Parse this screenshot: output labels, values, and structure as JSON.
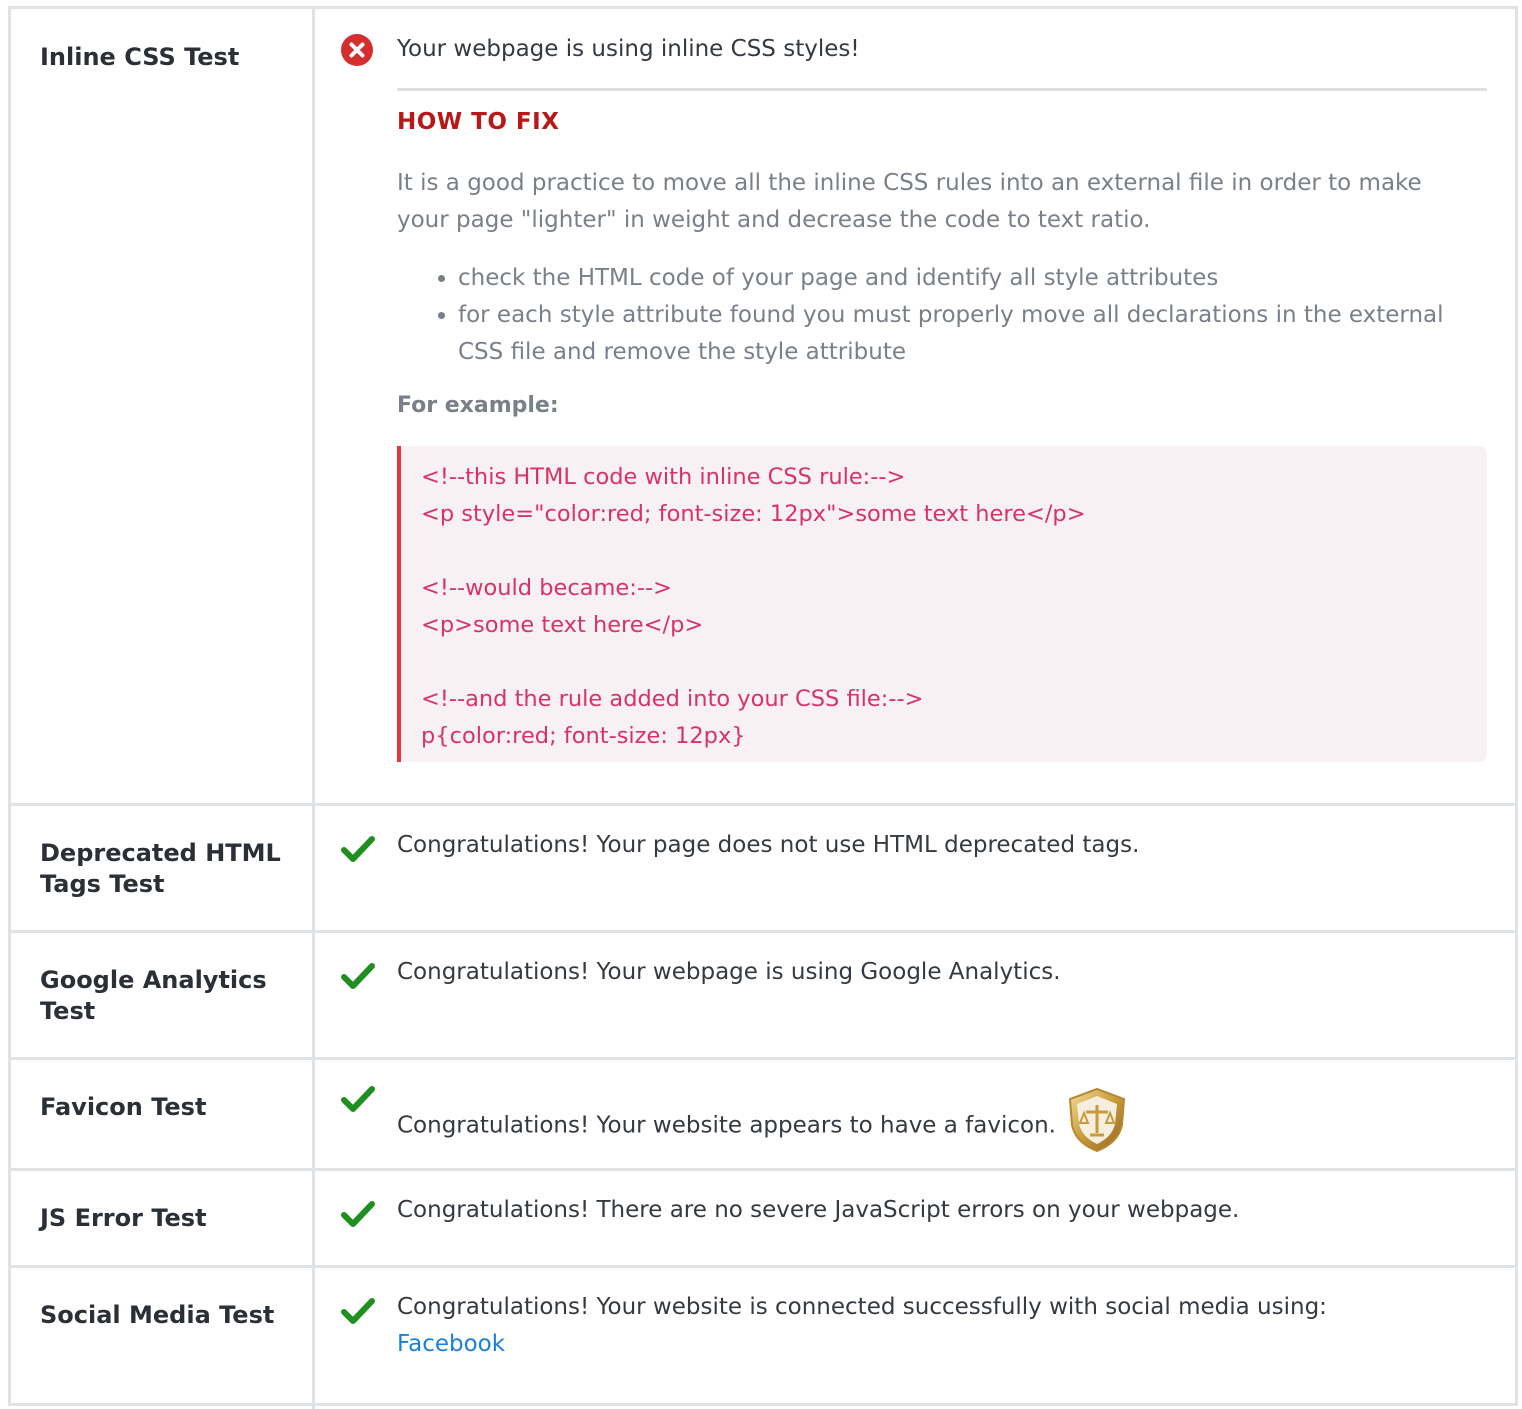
{
  "rows": [
    {
      "label": "Inline CSS Test",
      "status": "error",
      "message": "Your webpage is using inline CSS styles!",
      "how_to_fix": {
        "title": "HOW TO FIX",
        "paragraph": "It is a good practice to move all the inline CSS rules into an external file in order to make your page \"lighter\" in weight and decrease the code to text ratio.",
        "steps": [
          "check the HTML code of your page and identify all style attributes",
          "for each style attribute found you must properly move all declarations in the external CSS file and remove the style attribute"
        ],
        "example_label": "For example:",
        "code_lines": [
          "<!--this HTML code with inline CSS rule:-->",
          "<p style=\"color:red; font-size: 12px\">some text here</p>",
          "",
          "<!--would became:-->",
          "<p>some text here</p>",
          "",
          "<!--and the rule added into your CSS file:-->",
          "p{color:red; font-size: 12px}"
        ]
      }
    },
    {
      "label": "Deprecated HTML Tags Test",
      "status": "pass",
      "message": "Congratulations! Your page does not use HTML deprecated tags."
    },
    {
      "label": "Google Analytics Test",
      "status": "pass",
      "message": "Congratulations! Your webpage is using Google Analytics."
    },
    {
      "label": "Favicon Test",
      "status": "pass",
      "message": "Congratulations! Your website appears to have a favicon."
    },
    {
      "label": "JS Error Test",
      "status": "pass",
      "message": "Congratulations! There are no severe JavaScript errors on your webpage."
    },
    {
      "label": "Social Media Test",
      "status": "pass",
      "message": "Congratulations! Your website is connected successfully with social media using:",
      "link_text": "Facebook"
    }
  ],
  "colors": {
    "pass": "#1f8f1f",
    "error": "#d42e2e",
    "fix_title": "#b81818",
    "code": "#d63366",
    "link": "#1a7fd9"
  }
}
